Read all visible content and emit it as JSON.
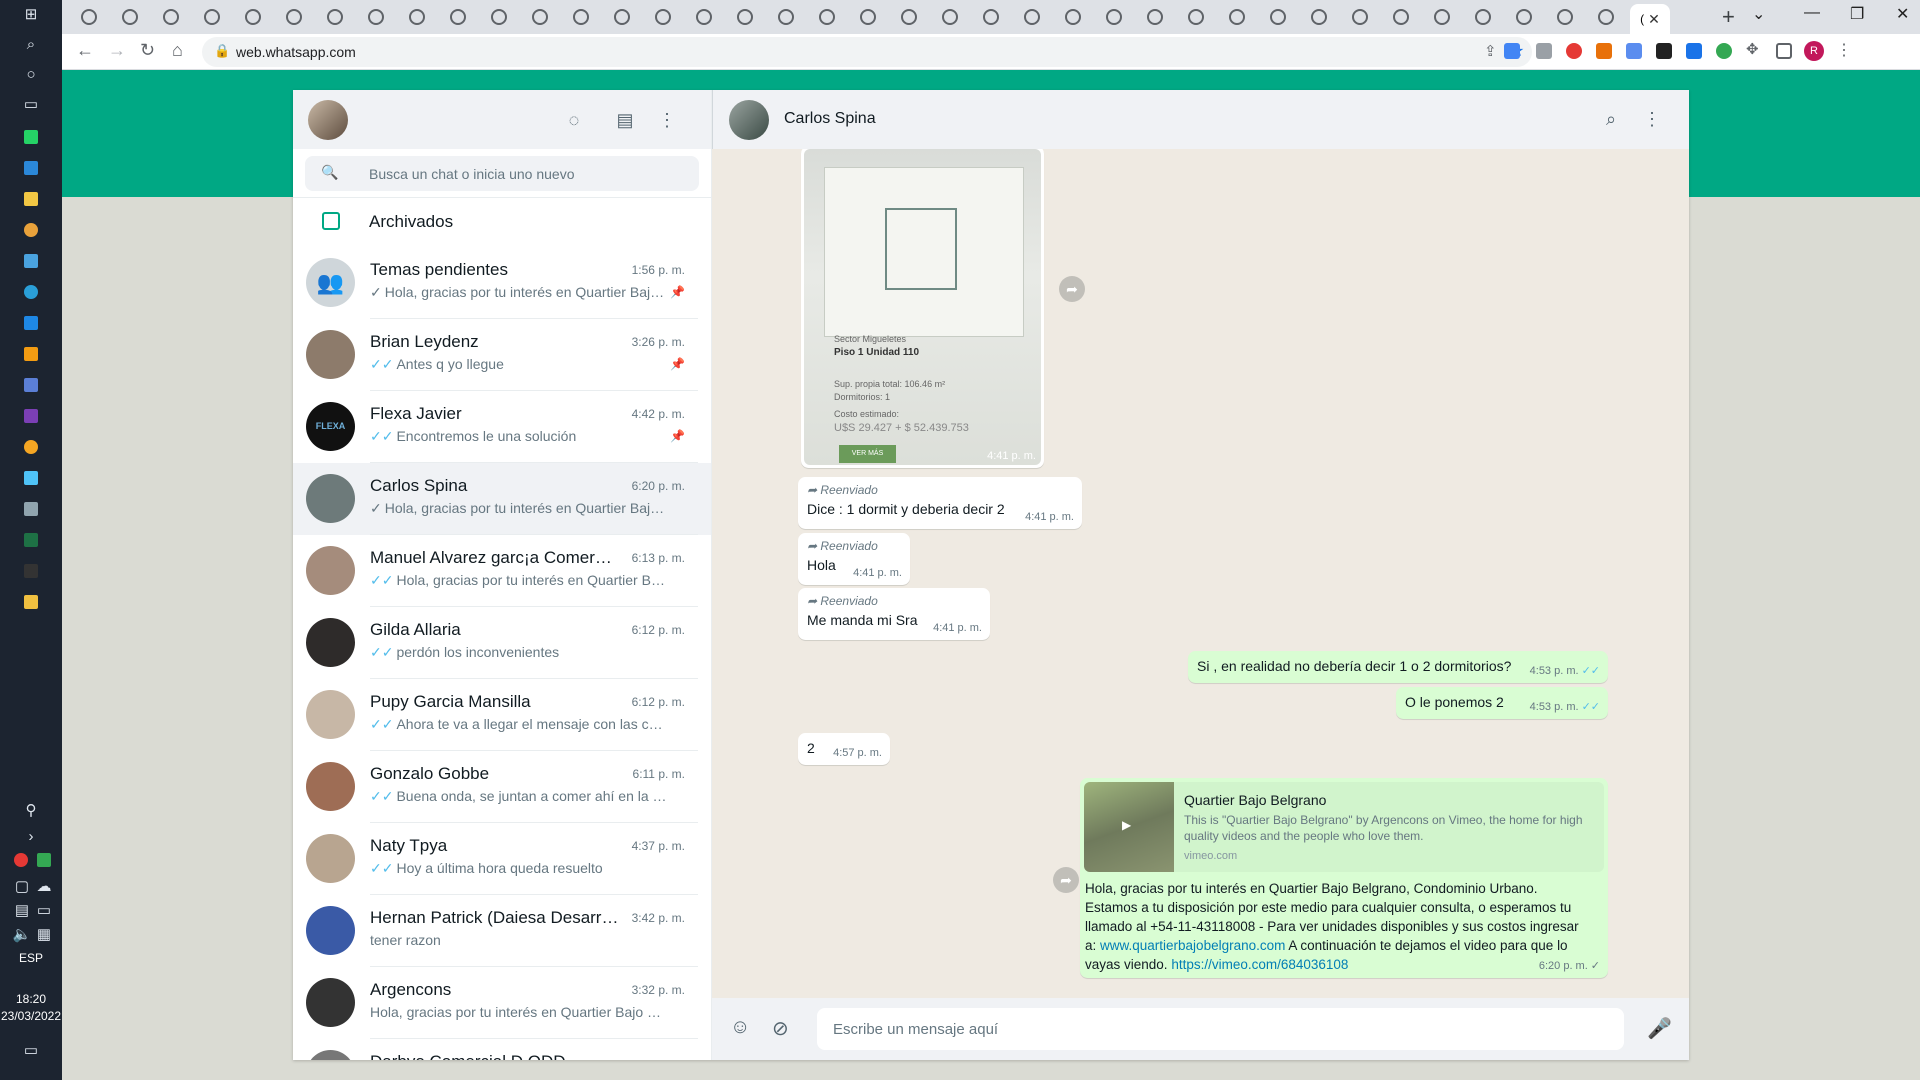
{
  "taskbar": {
    "lang": "ESP",
    "time": "18:20",
    "date": "23/03/2022"
  },
  "browser": {
    "url": "web.whatsapp.com",
    "active_tab_title": "(",
    "new_tab_symbol": "+",
    "tab_count": 38
  },
  "sidebar": {
    "search_placeholder": "Busca un chat o inicia uno nuevo",
    "archived_label": "Archivados",
    "chats": [
      {
        "name": "Temas pendientes",
        "time": "1:56 p. m.",
        "preview": "Hola, gracias por tu interés en Quartier Bajo ...",
        "tick": "✓",
        "pinned": true,
        "group": true
      },
      {
        "name": "Brian Leydenz",
        "time": "3:26 p. m.",
        "preview": "Antes q yo llegue",
        "tick": "✓✓",
        "pinned": true
      },
      {
        "name": "Flexa Javier",
        "time": "4:42 p. m.",
        "preview": "Encontremos le una solución",
        "tick": "✓✓",
        "pinned": true,
        "avatar_text": "FLEXA"
      },
      {
        "name": "Carlos Spina",
        "time": "6:20 p. m.",
        "preview": "Hola, gracias por tu interés en Quartier Bajo B...",
        "tick": "✓",
        "active": true
      },
      {
        "name": "Manuel Alvarez garc¡a Comercia...",
        "time": "6:13 p. m.",
        "preview": "Hola, gracias por tu interés en Quartier Bajo B...",
        "tick": "✓✓"
      },
      {
        "name": "Gilda Allaria",
        "time": "6:12 p. m.",
        "preview": "perdón los inconvenientes",
        "tick": "✓✓"
      },
      {
        "name": "Pupy Garcia Mansilla",
        "time": "6:12 p. m.",
        "preview": "Ahora te va a llegar el mensaje con las correcc...",
        "tick": "✓✓"
      },
      {
        "name": "Gonzalo Gobbe",
        "time": "6:11 p. m.",
        "preview": "Buena onda, se juntan a comer ahí en la casa ...",
        "tick": "✓✓"
      },
      {
        "name": "Naty Tpya",
        "time": "4:37 p. m.",
        "preview": "Hoy a última hora queda resuelto",
        "tick": "✓✓"
      },
      {
        "name": "Hernan Patrick (Daiesa Desarroll...",
        "time": "3:42 p. m.",
        "preview": "tener razon",
        "tick": ""
      },
      {
        "name": "Argencons",
        "time": "3:32 p. m.",
        "preview": "Hola, gracias por tu interés en Quartier Bajo Belg...",
        "tick": ""
      },
      {
        "name": "Darbyo Comercial D.ODD",
        "time": "",
        "preview": "",
        "tick": ""
      }
    ]
  },
  "conversation": {
    "contact_name": "Carlos Spina",
    "image_message": {
      "time": "4:41 p. m.",
      "sector": "Sector Migueletes",
      "unit": "Piso 1 Unidad 110",
      "line1": "Sup. propia total: 106.46 m²",
      "line2": "Dormitorios: 1",
      "line3": "Costo estimado:",
      "price": "U$S 29.427 + $ 52.439.753",
      "button": "VER MÁS"
    },
    "forwarded_label": "Reenviado",
    "messages": [
      {
        "text": "Dice : 1 dormit y deberia decir 2",
        "time": "4:41 p. m."
      },
      {
        "text": "Hola",
        "time": "4:41 p. m."
      },
      {
        "text": "Me manda mi Sra",
        "time": "4:41 p. m."
      },
      {
        "text": "Si , en realidad no debería decir 1 o 2 dormitorios?",
        "time": "4:53 p. m."
      },
      {
        "text": "O le ponemos 2",
        "time": "4:53 p. m."
      },
      {
        "text": "2",
        "time": "4:57 p. m."
      }
    ],
    "link_message": {
      "preview_title": "Quartier Bajo Belgrano",
      "preview_desc": "This is \"Quartier Bajo Belgrano\" by Argencons on Vimeo, the home for high quality videos and the people who love them.",
      "preview_domain": "vimeo.com",
      "text_a": "Hola, gracias por tu interés en Quartier Bajo Belgrano, Condominio Urbano. Estamos a tu disposición por este medio para cualquier consulta, o esperamos tu llamado al +54-11-43118008  - Para ver unidades disponibles y sus costos ingresar a: ",
      "link_1": "www.quartierbajobelgrano.com",
      "text_b": " A continuación te dejamos el video para que lo vayas viendo. ",
      "link_2": "https://vimeo.com/684036108",
      "time": "6:20 p. m."
    },
    "input_placeholder": "Escribe un mensaje aquí"
  },
  "colors": {
    "brand_green": "#00a884",
    "outgoing_bubble": "#d9fdd3",
    "read_tick": "#53bdeb",
    "chat_bg": "#efeae2"
  }
}
